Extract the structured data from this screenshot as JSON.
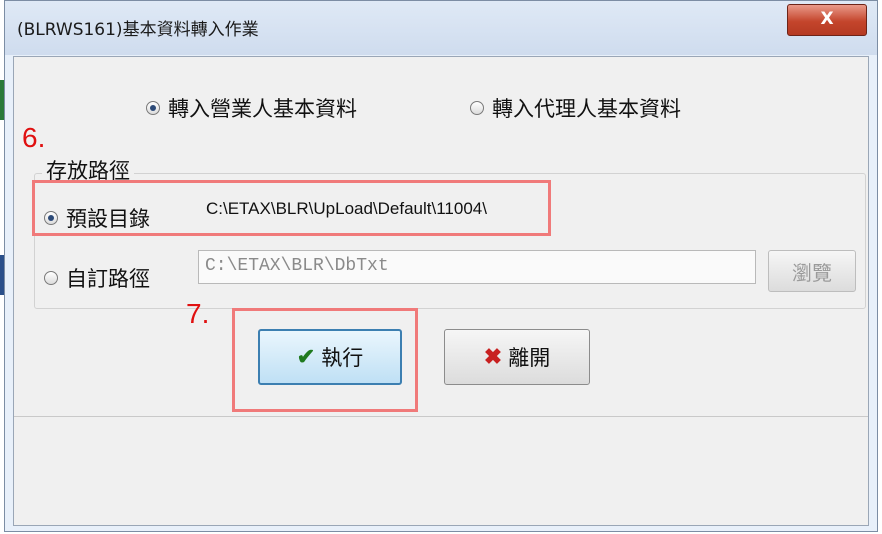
{
  "window": {
    "title": "(BLRWS161)基本資料轉入作業",
    "close_label": "X"
  },
  "import_type": {
    "options": [
      {
        "label": "轉入營業人基本資料",
        "selected": true
      },
      {
        "label": "轉入代理人基本資料",
        "selected": false
      }
    ]
  },
  "storage": {
    "legend": "存放路徑",
    "default_option": {
      "label": "預設目錄",
      "selected": true,
      "path": "C:\\ETAX\\BLR\\UpLoad\\Default\\11004\\"
    },
    "custom_option": {
      "label": "自訂路徑",
      "selected": false,
      "path": "C:\\ETAX\\BLR\\DbTxt"
    },
    "browse_label": "瀏覽"
  },
  "actions": {
    "run_label": "執行",
    "exit_label": "離開"
  },
  "annotations": {
    "step6": "6.",
    "step7": "7.",
    "color": "#f07a7a"
  },
  "colors": {
    "accent": "#3c7fb1",
    "close_button": "#c4452c"
  },
  "icons": {
    "run": "check-icon",
    "exit": "x-icon"
  }
}
